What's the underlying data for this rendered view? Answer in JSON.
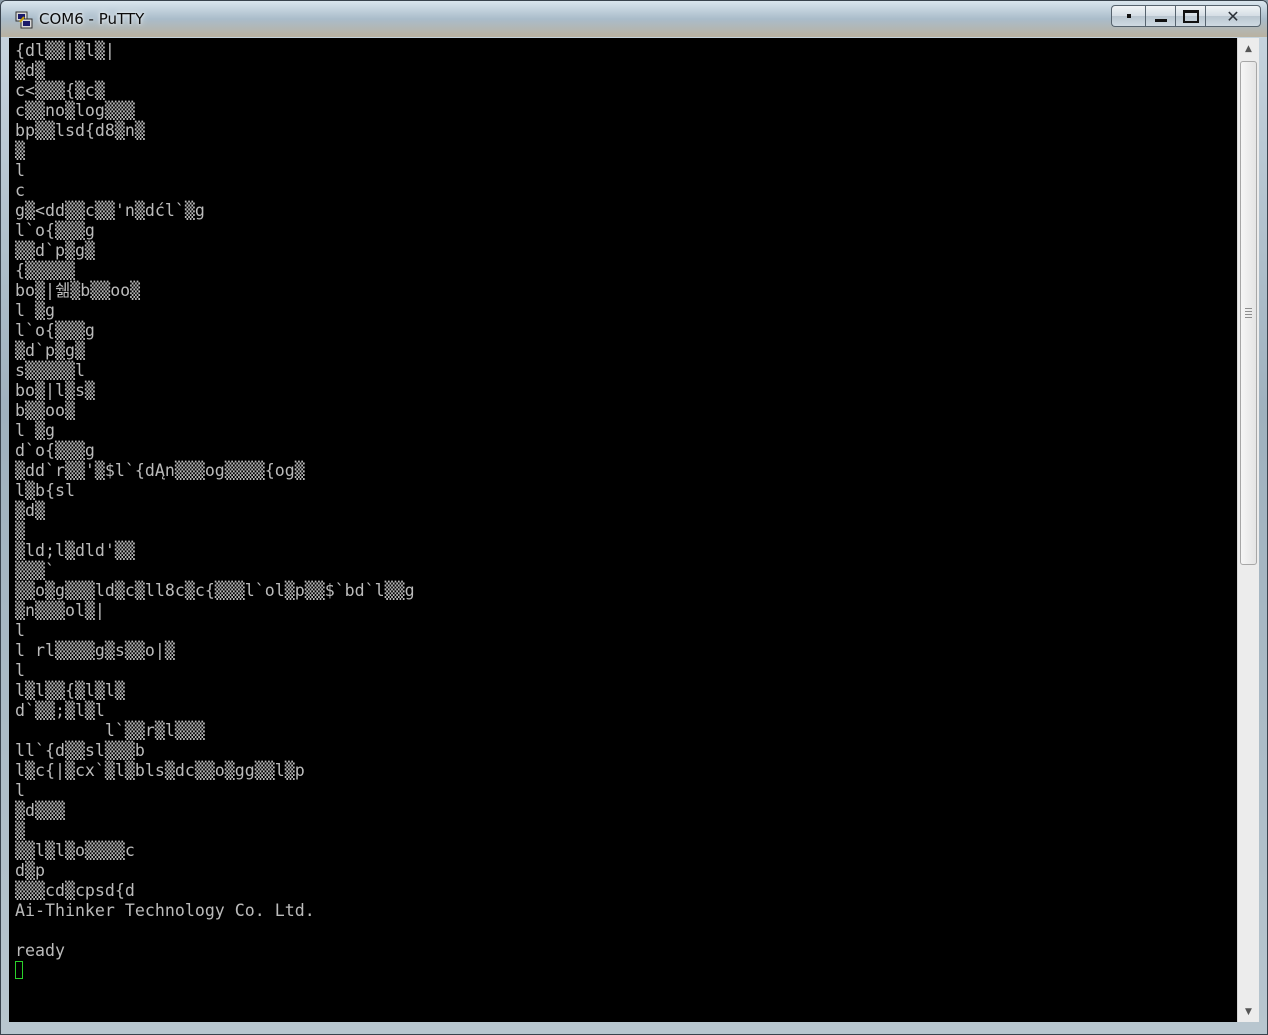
{
  "window": {
    "title": "COM6 - PuTTY",
    "icon": "putty-icon",
    "buttons": {
      "menu_icon": "system-menu-icon",
      "minimize_icon": "minimize-icon",
      "maximize_icon": "maximize-icon",
      "close_icon": "close-icon",
      "close_label": "✕"
    }
  },
  "terminal": {
    "colors": {
      "background": "#000000",
      "text": "#bbbbbb",
      "cursor": "#2bd12b"
    },
    "lines": [
      "{dl▒▒|▒l▒|",
      "▒d▒",
      "c<▒▒▒{▒c▒",
      "c▒▒no▒log▒▒▒",
      "bp▒▒lsd{d8▒n▒",
      "▒",
      "l",
      "c",
      "g▒<dd▒▒c▒▒'n▒dćl`▒g",
      "l`o{▒▒▒g",
      "▒▒d`p▒g▒",
      "{▒▒▒▒▒",
      "bo▒|쉚▒b▒▒oo▒",
      "l ▒g",
      "l`o{▒▒▒g",
      "▒d`p▒g▒",
      "s▒▒▒▒▒l",
      "bo▒|l▒s▒",
      "b▒▒oo▒",
      "l ▒g",
      "d`o{▒▒▒g",
      "▒dd`r▒▒'▒$l`{dĄn▒▒▒og▒▒▒▒{og▒",
      "l▒b{sl",
      "▒d▒",
      "▒",
      "▒ld;l▒dld'▒▒",
      "▒▒▒`",
      "▒▒o▒g▒▒▒ld▒c▒ll8c▒c{▒▒▒l`ol▒p▒▒$`bd`l▒▒g",
      "▒n▒▒▒ol▒|",
      "l",
      "l rl▒▒▒▒g▒s▒▒o|▒",
      "l",
      "l▒l▒▒{▒l▒l▒",
      "d`▒▒;▒l▒l",
      "         l`▒▒r▒l▒▒▒",
      "ll`{d▒▒sl▒▒▒b",
      "l▒c{|▒cx`▒l▒bls▒dc▒▒o▒gg▒▒l▒p",
      "l",
      "▒d▒▒▒",
      "▒",
      "▒▒l▒l▒o▒▒▒▒c",
      "d▒p",
      "▒▒▒cd▒cpsd{d",
      "Ai-Thinker Technology Co. Ltd.",
      "",
      "ready"
    ]
  },
  "scrollbar": {
    "up_icon": "scroll-up-arrow-icon",
    "down_icon": "scroll-down-arrow-icon",
    "up_glyph": "▲",
    "down_glyph": "▼"
  }
}
